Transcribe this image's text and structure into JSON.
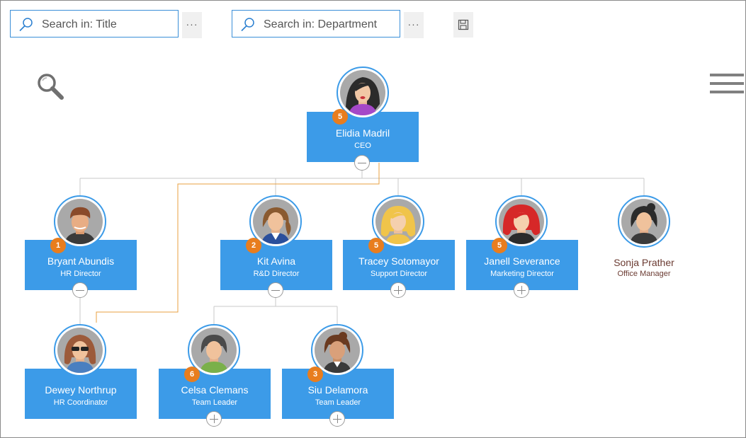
{
  "toolbar": {
    "search_title_placeholder": "Search in: Title",
    "search_department_placeholder": "Search in: Department",
    "more_label": "···",
    "icons": [
      "search-icon",
      "more-icon",
      "save-icon",
      "zoom-icon",
      "hamburger-menu-icon"
    ]
  },
  "colors": {
    "card": "#3c9be8",
    "badge": "#e87d1e",
    "highlight_path": "#e8a040",
    "connector": "#c8c8c8",
    "plain_text": "#6b3b32"
  },
  "nodes": {
    "elidia": {
      "name": "Elidia Madril",
      "title": "CEO",
      "badge": "5",
      "toggle": "collapse"
    },
    "bryant": {
      "name": "Bryant Abundis",
      "title": "HR Director",
      "badge": "1",
      "toggle": "collapse"
    },
    "kit": {
      "name": "Kit Avina",
      "title": "R&D Director",
      "badge": "2",
      "toggle": "collapse"
    },
    "tracey": {
      "name": "Tracey Sotomayor",
      "title": "Support Director",
      "badge": "5",
      "toggle": "expand"
    },
    "janell": {
      "name": "Janell Severance",
      "title": "Marketing Director",
      "badge": "5",
      "toggle": "expand"
    },
    "sonja": {
      "name": "Sonja Prather",
      "title": "Office Manager"
    },
    "dewey": {
      "name": "Dewey Northrup",
      "title": "HR Coordinator"
    },
    "celsa": {
      "name": "Celsa Clemans",
      "title": "Team Leader",
      "badge": "6",
      "toggle": "expand"
    },
    "siu": {
      "name": "Siu Delamora",
      "title": "Team Leader",
      "badge": "3",
      "toggle": "expand"
    }
  }
}
